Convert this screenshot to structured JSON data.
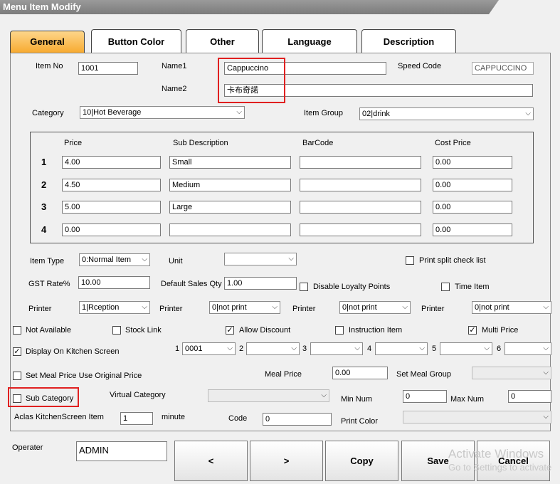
{
  "window": {
    "title": "Menu Item Modify"
  },
  "tabs": [
    "General",
    "Button Color",
    "Other",
    "Language",
    "Description"
  ],
  "general": {
    "item_no_label": "Item No",
    "item_no": "1001",
    "name1_label": "Name1",
    "name1": "Cappuccino",
    "name2_label": "Name2",
    "name2": "卡布奇諾",
    "speed_code_label": "Speed Code",
    "speed_code": "CAPPUCCINO",
    "category_label": "Category",
    "category": "10|Hot Beverage",
    "item_group_label": "Item Group",
    "item_group": "02|drink"
  },
  "price_grid": {
    "headers": {
      "price": "Price",
      "sub_description": "Sub Description",
      "barcode": "BarCode",
      "cost_price": "Cost Price"
    },
    "rows": [
      {
        "num": "1",
        "price": "4.00",
        "sub": "Small",
        "barcode": "",
        "cost": "0.00"
      },
      {
        "num": "2",
        "price": "4.50",
        "sub": "Medium",
        "barcode": "",
        "cost": "0.00"
      },
      {
        "num": "3",
        "price": "5.00",
        "sub": "Large",
        "barcode": "",
        "cost": "0.00"
      },
      {
        "num": "4",
        "price": "0.00",
        "sub": "",
        "barcode": "",
        "cost": "0.00"
      }
    ]
  },
  "item_type": {
    "label": "Item Type",
    "value": "0:Normal Item"
  },
  "unit": {
    "label": "Unit",
    "value": ""
  },
  "print_split": {
    "label": "Print split check list",
    "checked": false
  },
  "gst": {
    "label": "GST Rate%",
    "value": "10.00"
  },
  "default_qty": {
    "label": "Default Sales Qty",
    "value": "1.00"
  },
  "disable_loyalty": {
    "label": "Disable Loyalty Points",
    "checked": false
  },
  "time_item": {
    "label": "Time Item",
    "checked": false
  },
  "printers": {
    "label": "Printer",
    "values": [
      "1|Rception",
      "0|not print",
      "0|not print",
      "0|not print"
    ]
  },
  "flags": {
    "not_available": {
      "label": "Not Available",
      "checked": false
    },
    "stock_link": {
      "label": "Stock Link",
      "checked": false
    },
    "allow_discount": {
      "label": "Allow Discount",
      "checked": true
    },
    "instruction_item": {
      "label": "Instruction Item",
      "checked": false
    },
    "multi_price": {
      "label": "Multi Price",
      "checked": true
    },
    "display_kitchen": {
      "label": "Display On Kitchen Screen",
      "checked": true
    },
    "set_meal_original": {
      "label": "Set Meal Price Use Original Price",
      "checked": false
    },
    "sub_category": {
      "label": "Sub Category",
      "checked": false
    }
  },
  "kitchen_screens": [
    {
      "num": "1",
      "value": "0001"
    },
    {
      "num": "2",
      "value": ""
    },
    {
      "num": "3",
      "value": ""
    },
    {
      "num": "4",
      "value": ""
    },
    {
      "num": "5",
      "value": ""
    },
    {
      "num": "6",
      "value": ""
    }
  ],
  "meal_price": {
    "label": "Meal Price",
    "value": "0.00"
  },
  "set_meal_group": {
    "label": "Set Meal Group",
    "value": ""
  },
  "virtual_category": {
    "label": "Virtual Category",
    "value": ""
  },
  "min_num": {
    "label": "Min Num",
    "value": "0"
  },
  "max_num": {
    "label": "Max Num",
    "value": "0"
  },
  "aclas": {
    "label": "Aclas KitchenScreen Item",
    "value": "1",
    "unit": "minute"
  },
  "code": {
    "label": "Code",
    "value": "0"
  },
  "print_color": {
    "label": "Print Color",
    "value": ""
  },
  "footer": {
    "operator_label": "Operater",
    "operator": "ADMIN",
    "prev": "<",
    "next": ">",
    "copy": "Copy",
    "save": "Save",
    "cancel": "Cancel"
  },
  "watermark": {
    "line1": "Activate Windows",
    "line2": "Go to Settings to activate"
  },
  "colors": {
    "tab_active": "#f7a92e",
    "highlight": "#e02020"
  }
}
